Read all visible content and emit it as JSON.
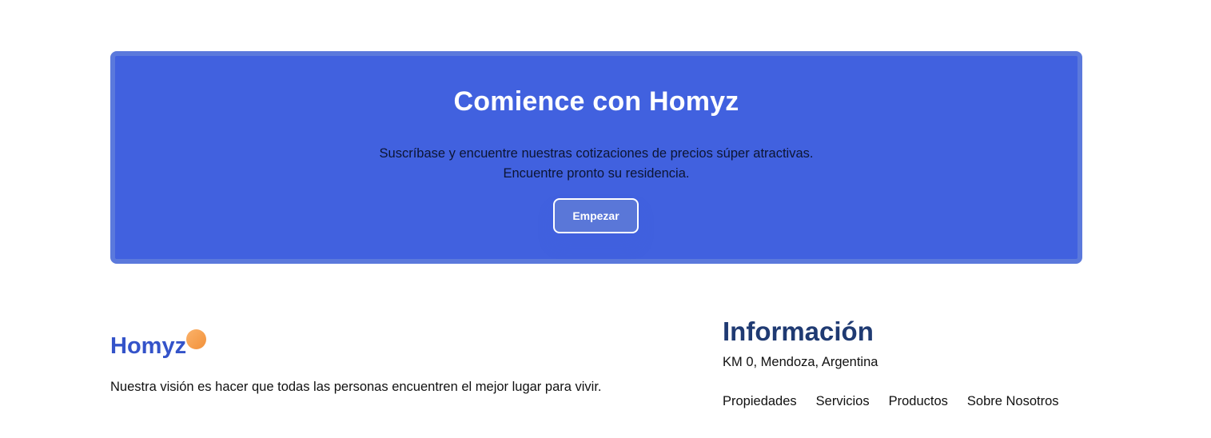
{
  "banner": {
    "title": "Comience con Homyz",
    "subtitle_line1": "Suscríbase y encuentre nuestras cotizaciones de precios súper atractivas.",
    "subtitle_line2": "Encuentre pronto su residencia.",
    "cta_label": "Empezar"
  },
  "brand": {
    "name": "Homyz",
    "vision": "Nuestra visión es hacer que todas las personas encuentren el mejor lugar para vivir."
  },
  "info": {
    "title": "Información",
    "address": "KM 0, Mendoza, Argentina",
    "links": [
      "Propiedades",
      "Servicios",
      "Productos",
      "Sobre Nosotros"
    ]
  },
  "colors": {
    "banner_bg": "#4161df",
    "brand_blue": "#3453c9",
    "heading_navy": "#1f3a72",
    "dot_orange": "#f2913a"
  }
}
